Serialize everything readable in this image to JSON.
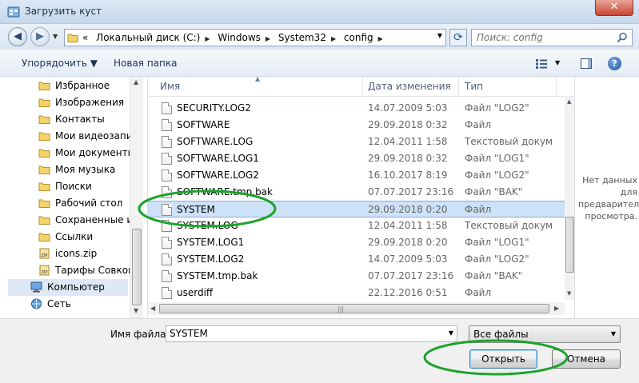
{
  "window": {
    "title": "Загрузить куст",
    "close_label": "✕"
  },
  "address": {
    "overflow": "«",
    "crumbs": [
      "Локальный диск (C:)",
      "Windows",
      "System32",
      "config"
    ],
    "search_placeholder": "Поиск: config"
  },
  "toolbar": {
    "organize_label": "Упорядочить ▼",
    "new_folder_label": "Новая папка",
    "help_label": "?"
  },
  "sidebar": {
    "items": [
      {
        "label": "Избранное",
        "icon": "folder-star-icon"
      },
      {
        "label": "Изображения",
        "icon": "folder-icon"
      },
      {
        "label": "Контакты",
        "icon": "folder-icon"
      },
      {
        "label": "Мои видеозаписи",
        "icon": "folder-icon"
      },
      {
        "label": "Мои документы",
        "icon": "folder-icon"
      },
      {
        "label": "Моя музыка",
        "icon": "folder-icon"
      },
      {
        "label": "Поиски",
        "icon": "folder-icon"
      },
      {
        "label": "Рабочий стол",
        "icon": "folder-icon"
      },
      {
        "label": "Сохраненные игры",
        "icon": "folder-icon"
      },
      {
        "label": "Ссылки",
        "icon": "folder-icon"
      },
      {
        "label": "icons.zip",
        "icon": "zip-icon"
      },
      {
        "label": "Тарифы Совкомбанк",
        "icon": "zip-icon"
      },
      {
        "label": "Компьютер",
        "icon": "computer-icon"
      },
      {
        "label": "Сеть",
        "icon": "network-icon"
      }
    ]
  },
  "columns": {
    "name": "Имя",
    "date": "Дата изменения",
    "type": "Тип"
  },
  "files": [
    {
      "name": "SECURITY.LOG2",
      "date": "14.07.2009 5:03",
      "type": "Файл \"LOG2\""
    },
    {
      "name": "SOFTWARE",
      "date": "29.09.2018 0:32",
      "type": "Файл"
    },
    {
      "name": "SOFTWARE.LOG",
      "date": "12.04.2011 1:58",
      "type": "Текстовый документ"
    },
    {
      "name": "SOFTWARE.LOG1",
      "date": "29.09.2018 0:32",
      "type": "Файл \"LOG1\""
    },
    {
      "name": "SOFTWARE.LOG2",
      "date": "16.10.2017 8:19",
      "type": "Файл \"LOG2\""
    },
    {
      "name": "SOFTWARE.tmp.bak",
      "date": "07.07.2017 23:16",
      "type": "Файл \"BAK\""
    },
    {
      "name": "SYSTEM",
      "date": "29.09.2018 0:20",
      "type": "Файл"
    },
    {
      "name": "SYSTEM.LOG",
      "date": "12.04.2011 1:58",
      "type": "Текстовый документ"
    },
    {
      "name": "SYSTEM.LOG1",
      "date": "29.09.2018 0:20",
      "type": "Файл \"LOG1\""
    },
    {
      "name": "SYSTEM.LOG2",
      "date": "14.07.2009 5:03",
      "type": "Файл \"LOG2\""
    },
    {
      "name": "SYSTEM.tmp.bak",
      "date": "07.07.2017 23:16",
      "type": "Файл \"BAK\""
    },
    {
      "name": "userdiff",
      "date": "22.12.2016 0:51",
      "type": "Файл"
    }
  ],
  "preview": {
    "message": "Нет данных для предварительного просмотра."
  },
  "footer": {
    "filename_label": "Имя файла:",
    "filename_value": "SYSTEM",
    "filter_value": "Все файлы",
    "open_label": "Открыть",
    "cancel_label": "Отмена"
  },
  "colors": {
    "selection": "#cde1f7",
    "annotation": "#1aa32a"
  }
}
